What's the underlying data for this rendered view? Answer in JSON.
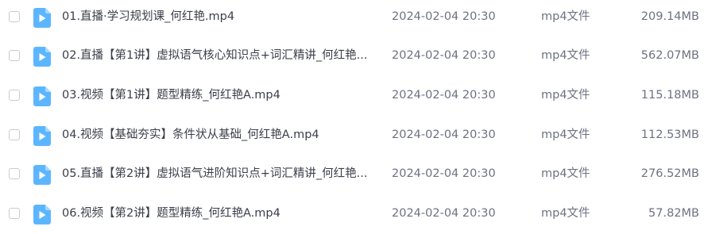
{
  "files": [
    {
      "name": "01.直播·学习规划课_何红艳.mp4",
      "date": "2024-02-04 20:30",
      "type": "mp4文件",
      "size": "209.14MB",
      "icon": "video-file-icon"
    },
    {
      "name": "02.直播【第1讲】虚拟语气核心知识点+词汇精讲_何红艳...",
      "date": "2024-02-04 20:30",
      "type": "mp4文件",
      "size": "562.07MB",
      "icon": "video-file-icon"
    },
    {
      "name": "03.视频【第1讲】题型精练_何红艳A.mp4",
      "date": "2024-02-04 20:30",
      "type": "mp4文件",
      "size": "115.18MB",
      "icon": "video-file-icon"
    },
    {
      "name": "04.视频【基础夯实】条件状从基础_何红艳A.mp4",
      "date": "2024-02-04 20:30",
      "type": "mp4文件",
      "size": "112.53MB",
      "icon": "video-file-icon"
    },
    {
      "name": "05.直播【第2讲】虚拟语气进阶知识点+词汇精讲_何红艳...",
      "date": "2024-02-04 20:30",
      "type": "mp4文件",
      "size": "276.52MB",
      "icon": "video-file-icon"
    },
    {
      "name": "06.视频【第2讲】题型精练_何红艳A.mp4",
      "date": "2024-02-04 20:30",
      "type": "mp4文件",
      "size": "57.82MB",
      "icon": "video-file-icon"
    }
  ],
  "colors": {
    "icon_fill": "#5cb6ff",
    "icon_fold": "#a9d8ff",
    "text_primary": "#3b3f4a",
    "text_secondary": "#6d7280",
    "checkbox_border": "#c9ccd3"
  }
}
